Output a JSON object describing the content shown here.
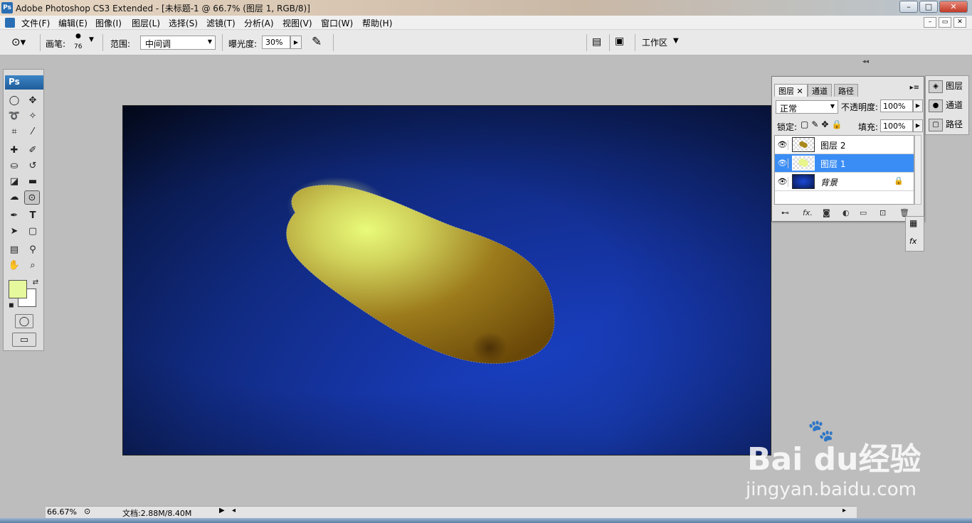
{
  "window": {
    "title": "Adobe Photoshop CS3 Extended - [未标题-1 @ 66.7% (图层 1, RGB/8)]",
    "app_badge": "Ps",
    "min": "–",
    "max": "□",
    "close": "✕"
  },
  "menu": {
    "items": [
      "文件(F)",
      "编辑(E)",
      "图像(I)",
      "图层(L)",
      "选择(S)",
      "滤镜(T)",
      "分析(A)",
      "视图(V)",
      "窗口(W)",
      "帮助(H)"
    ]
  },
  "options": {
    "brush_label": "画笔:",
    "brush_size": "76",
    "range_label": "范围:",
    "range_value": "中间调",
    "exposure_label": "曝光度:",
    "exposure_value": "30%",
    "workspace": "工作区"
  },
  "toolbox": {
    "badge": "Ps"
  },
  "colors": {
    "foreground": "#e6f99c",
    "background": "#ffffff",
    "selected_layer": "#3a8df4"
  },
  "status": {
    "zoom": "66.67%",
    "doc_info": "文档:2.88M/8.40M"
  },
  "panels": {
    "tabs": [
      "图层",
      "通道",
      "路径"
    ],
    "blend_mode": "正常",
    "opacity_label": "不透明度:",
    "opacity_value": "100%",
    "lock_label": "锁定:",
    "fill_label": "填充:",
    "fill_value": "100%",
    "layers": [
      {
        "name": "图层 2",
        "selected": false,
        "locked": false
      },
      {
        "name": "图层 1",
        "selected": true,
        "locked": false
      },
      {
        "name": "背景",
        "selected": false,
        "locked": true
      }
    ],
    "collapsed": [
      "图层",
      "通道",
      "路径"
    ]
  },
  "watermark": {
    "logo": "Bai du经验",
    "url": "jingyan.baidu.com"
  }
}
